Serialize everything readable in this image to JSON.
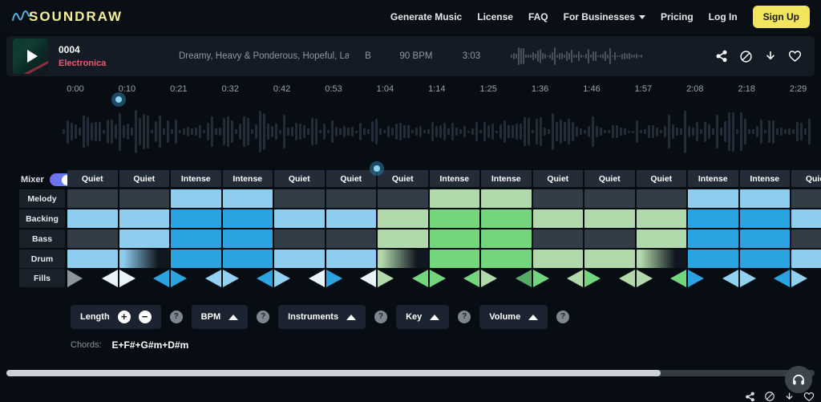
{
  "nav": {
    "logo_text": "SOUNDRAW",
    "items": [
      {
        "label": "Generate Music",
        "caret": false
      },
      {
        "label": "License",
        "caret": false
      },
      {
        "label": "FAQ",
        "caret": false
      },
      {
        "label": "For Businesses",
        "caret": true
      },
      {
        "label": "Pricing",
        "caret": false
      },
      {
        "label": "Log In",
        "caret": false
      }
    ],
    "signup_label": "Sign Up"
  },
  "track": {
    "id": "0004",
    "genre": "Electronica",
    "description": "Dreamy, Heavy & Ponderous, Hopeful, Laid ...",
    "key": "B",
    "bpm": "90 BPM",
    "duration": "3:03"
  },
  "timeline": {
    "labels": [
      "0:00",
      "0:10",
      "0:21",
      "0:32",
      "0:42",
      "0:53",
      "1:04",
      "1:14",
      "1:25",
      "1:36",
      "1:46",
      "1:57",
      "2:08",
      "2:18",
      "2:29"
    ]
  },
  "mixer": {
    "toggle_label": "Mixer",
    "toggle_state": "on",
    "column_headers": [
      "Quiet",
      "Quiet",
      "Intense",
      "Intense",
      "Quiet",
      "Quiet",
      "Quiet",
      "Intense",
      "Intense",
      "Quiet",
      "Quiet",
      "Quiet",
      "Intense",
      "Intense",
      "Quiet"
    ],
    "rows": [
      {
        "label": "Melody",
        "cells": [
          "dark",
          "dark",
          "lightblue",
          "lightblue",
          "dark",
          "dark",
          "dark",
          "palegreen",
          "palegreen",
          "dark",
          "dark",
          "dark",
          "lightblue",
          "lightblue",
          "dark"
        ]
      },
      {
        "label": "Backing",
        "cells": [
          "lightblue",
          "lightblue",
          "blue",
          "blue",
          "lightblue",
          "lightblue",
          "palegreen",
          "green",
          "green",
          "palegreen",
          "palegreen",
          "palegreen",
          "blue",
          "blue",
          "lightblue"
        ]
      },
      {
        "label": "Bass",
        "cells": [
          "dark",
          "lightblue",
          "blue",
          "blue",
          "dark",
          "dark",
          "palegreen",
          "green",
          "green",
          "dark",
          "dark",
          "palegreen",
          "blue",
          "blue",
          "dark"
        ]
      },
      {
        "label": "Drum",
        "cells": [
          "lightblue",
          "fade-blue",
          "blue",
          "blue",
          "lightblue",
          "lightblue",
          "fade-green",
          "green",
          "green",
          "palegreen",
          "palegreen",
          "fade-green",
          "blue",
          "blue",
          "lightblue"
        ]
      }
    ],
    "fills_label": "Fills",
    "fills_start": "gray",
    "fills_diamonds": [
      [
        "white",
        "white"
      ],
      [
        "blue",
        "blue"
      ],
      [
        "lightblue",
        "lightblue"
      ],
      [
        "blue",
        "lightblue"
      ],
      [
        "white",
        "blue"
      ],
      [
        "white",
        "palegreen"
      ],
      [
        "green",
        "green"
      ],
      [
        "green",
        "palegreen"
      ],
      [
        "darkgreen",
        "green"
      ],
      [
        "palegreen",
        "green"
      ],
      [
        "palegreen",
        "palegreen"
      ],
      [
        "green",
        "blue"
      ],
      [
        "lightblue",
        "lightblue"
      ],
      [
        "blue",
        "lightblue"
      ]
    ]
  },
  "controls": {
    "length_label": "Length",
    "plus_label": "+",
    "minus_label": "−",
    "bpm_label": "BPM",
    "instruments_label": "Instruments",
    "key_label": "Key",
    "volume_label": "Volume",
    "help_label": "?"
  },
  "chords": {
    "label": "Chords:",
    "value": "E+F#+G#m+D#m"
  },
  "colors": {
    "accent_yellow": "#f2e55c",
    "genre_red": "#e4606e",
    "cell_dark": "#333d47",
    "cell_lightblue": "#8ecdee",
    "cell_blue": "#2ba3e0",
    "cell_palegreen": "#b2d9ab",
    "cell_green": "#73d67d",
    "playhead_blue": "#8ed4f0"
  }
}
